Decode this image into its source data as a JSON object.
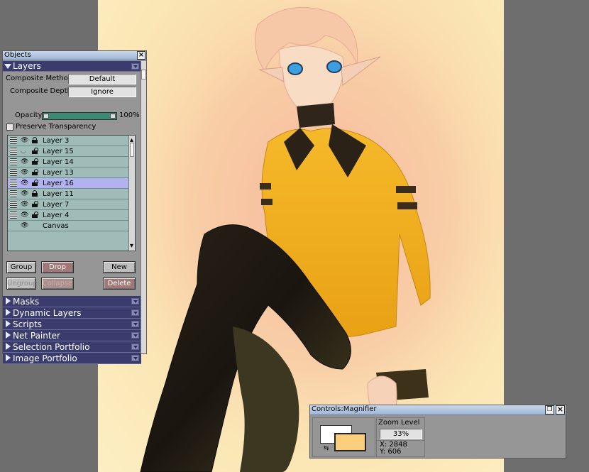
{
  "objects_panel": {
    "title": "Objects",
    "layers_section": {
      "header": "Layers",
      "composite_method_label": "Composite Method",
      "composite_method_value": "Default",
      "composite_depth_label": "Composite Depth",
      "composite_depth_value": "Ignore",
      "opacity_label": "Opacity",
      "opacity_value": "100%",
      "preserve_transparency_label": "Preserve Transparency",
      "layers": [
        {
          "name": "Layer 3",
          "visible": true,
          "locked": true
        },
        {
          "name": "Layer 15",
          "visible": false,
          "locked": false
        },
        {
          "name": "Layer 14",
          "visible": true,
          "locked": false
        },
        {
          "name": "Layer 13",
          "visible": true,
          "locked": false
        },
        {
          "name": "Layer 16",
          "visible": true,
          "locked": false,
          "selected": true
        },
        {
          "name": "Layer 11",
          "visible": true,
          "locked": true
        },
        {
          "name": "Layer 7",
          "visible": true,
          "locked": false
        },
        {
          "name": "Layer 4",
          "visible": true,
          "locked": false
        },
        {
          "name": "Canvas",
          "visible": true,
          "locked": false
        }
      ],
      "buttons": {
        "group": "Group",
        "drop": "Drop",
        "new": "New",
        "ungroup": "Ungroup",
        "collapse": "Collapse",
        "delete": "Delete"
      }
    },
    "collapsed_sections": [
      "Masks",
      "Dynamic Layers",
      "Scripts",
      "Net Painter",
      "Selection Portfolio",
      "Image Portfolio"
    ]
  },
  "magnifier_panel": {
    "title": "Controls:Magnifier",
    "zoom_label": "Zoom Level",
    "zoom_value": "33%",
    "x_readout": "X: 2848",
    "y_readout": "Y: 606",
    "primary_color": "#fbcf7e",
    "secondary_color": "#ffffff"
  },
  "colors": {
    "section_header_bg": "#3a3c6e",
    "layer_list_bg": "#9fbcb8",
    "selected_layer_bg": "#b2b2f0",
    "jacket_yellow": "#f2b21e",
    "canvas_bg": "#fbe2b0"
  }
}
